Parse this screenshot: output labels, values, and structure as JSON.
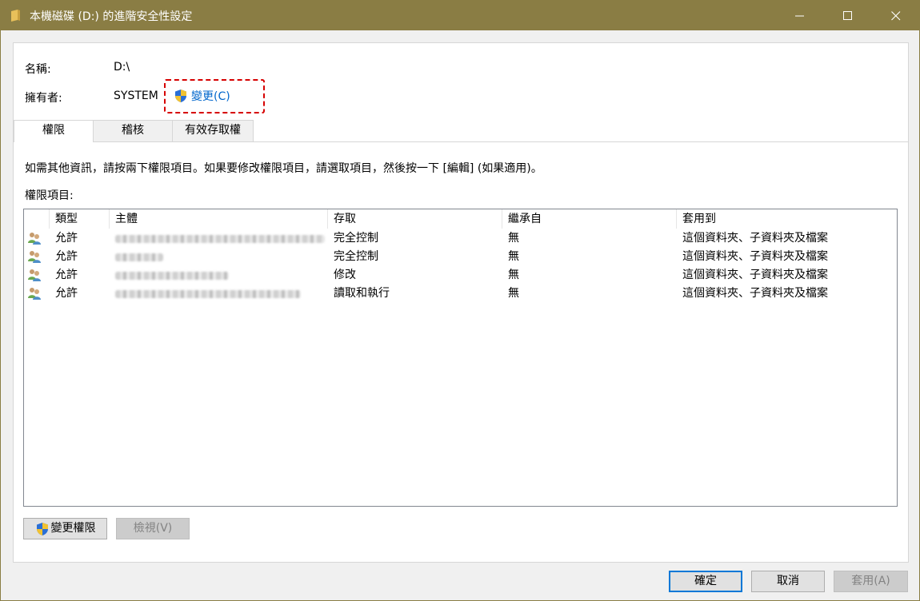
{
  "window": {
    "title": "本機磁碟 (D:) 的進階安全性設定",
    "title_bar_color": "#8a7d44"
  },
  "details": {
    "name_label": "名稱:",
    "name_value": "D:\\",
    "owner_label": "擁有者:",
    "owner_value": "SYSTEM",
    "change_owner_link": "變更(C)"
  },
  "tabs": [
    {
      "label": "權限",
      "active": true
    },
    {
      "label": "稽核",
      "active": false
    },
    {
      "label": "有效存取權",
      "active": false
    }
  ],
  "info_text": "如需其他資訊，請按兩下權限項目。如果要修改權限項目，請選取項目，然後按一下 [編輯] (如果適用)。",
  "entries_label": "權限項目:",
  "columns": [
    "類型",
    "主體",
    "存取",
    "繼承自",
    "套用到"
  ],
  "rows": [
    {
      "type": "允許",
      "access": "完全控制",
      "inherited": "無",
      "applies": "這個資料夾、子資料夾及檔案"
    },
    {
      "type": "允許",
      "access": "完全控制",
      "inherited": "無",
      "applies": "這個資料夾、子資料夾及檔案"
    },
    {
      "type": "允許",
      "access": "修改",
      "inherited": "無",
      "applies": "這個資料夾、子資料夾及檔案"
    },
    {
      "type": "允許",
      "access": "讀取和執行",
      "inherited": "無",
      "applies": "這個資料夾、子資料夾及檔案"
    }
  ],
  "buttons": {
    "change_permissions": "變更權限",
    "view": "檢視(V)",
    "ok": "確定",
    "cancel": "取消",
    "apply": "套用(A)"
  },
  "icons": {
    "uac_shield": "uac-shield-icon",
    "users": "users-icon",
    "folder": "folder-icon"
  },
  "colors": {
    "link": "#0066cc",
    "highlight_border": "#d60000",
    "default_button_border": "#0078d7"
  }
}
